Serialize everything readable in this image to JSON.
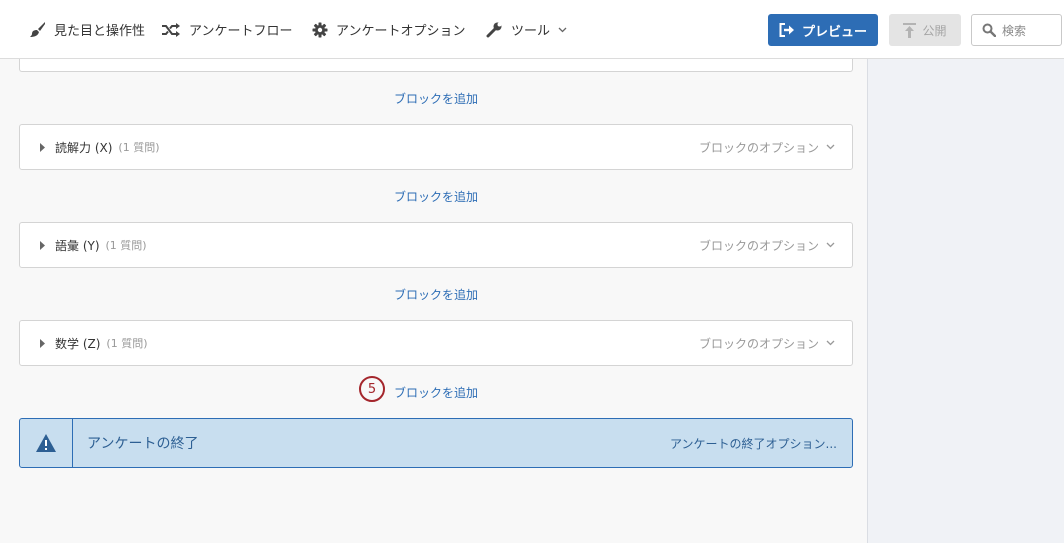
{
  "toolbar": {
    "look_and_feel": "見た目と操作性",
    "survey_flow": "アンケートフロー",
    "survey_options": "アンケートオプション",
    "tools": "ツール",
    "preview": "プレビュー",
    "publish": "公開",
    "search_placeholder": "検索"
  },
  "add_block_label": "ブロックを追加",
  "blocks": [
    {
      "name": "読解力 (X)",
      "count": "(1 質問)",
      "options": "ブロックのオプション"
    },
    {
      "name": "語彙 (Y)",
      "count": "(1 質問)",
      "options": "ブロックのオプション"
    },
    {
      "name": "数学 (Z)",
      "count": "(1 質問)",
      "options": "ブロックのオプション"
    }
  ],
  "step_marker": "5",
  "end_of_survey": {
    "title": "アンケートの終了",
    "options": "アンケートの終了オプション..."
  },
  "colors": {
    "accent": "#2d6db5",
    "step_marker": "#a4262c",
    "end_bar_bg": "#c8deef"
  }
}
